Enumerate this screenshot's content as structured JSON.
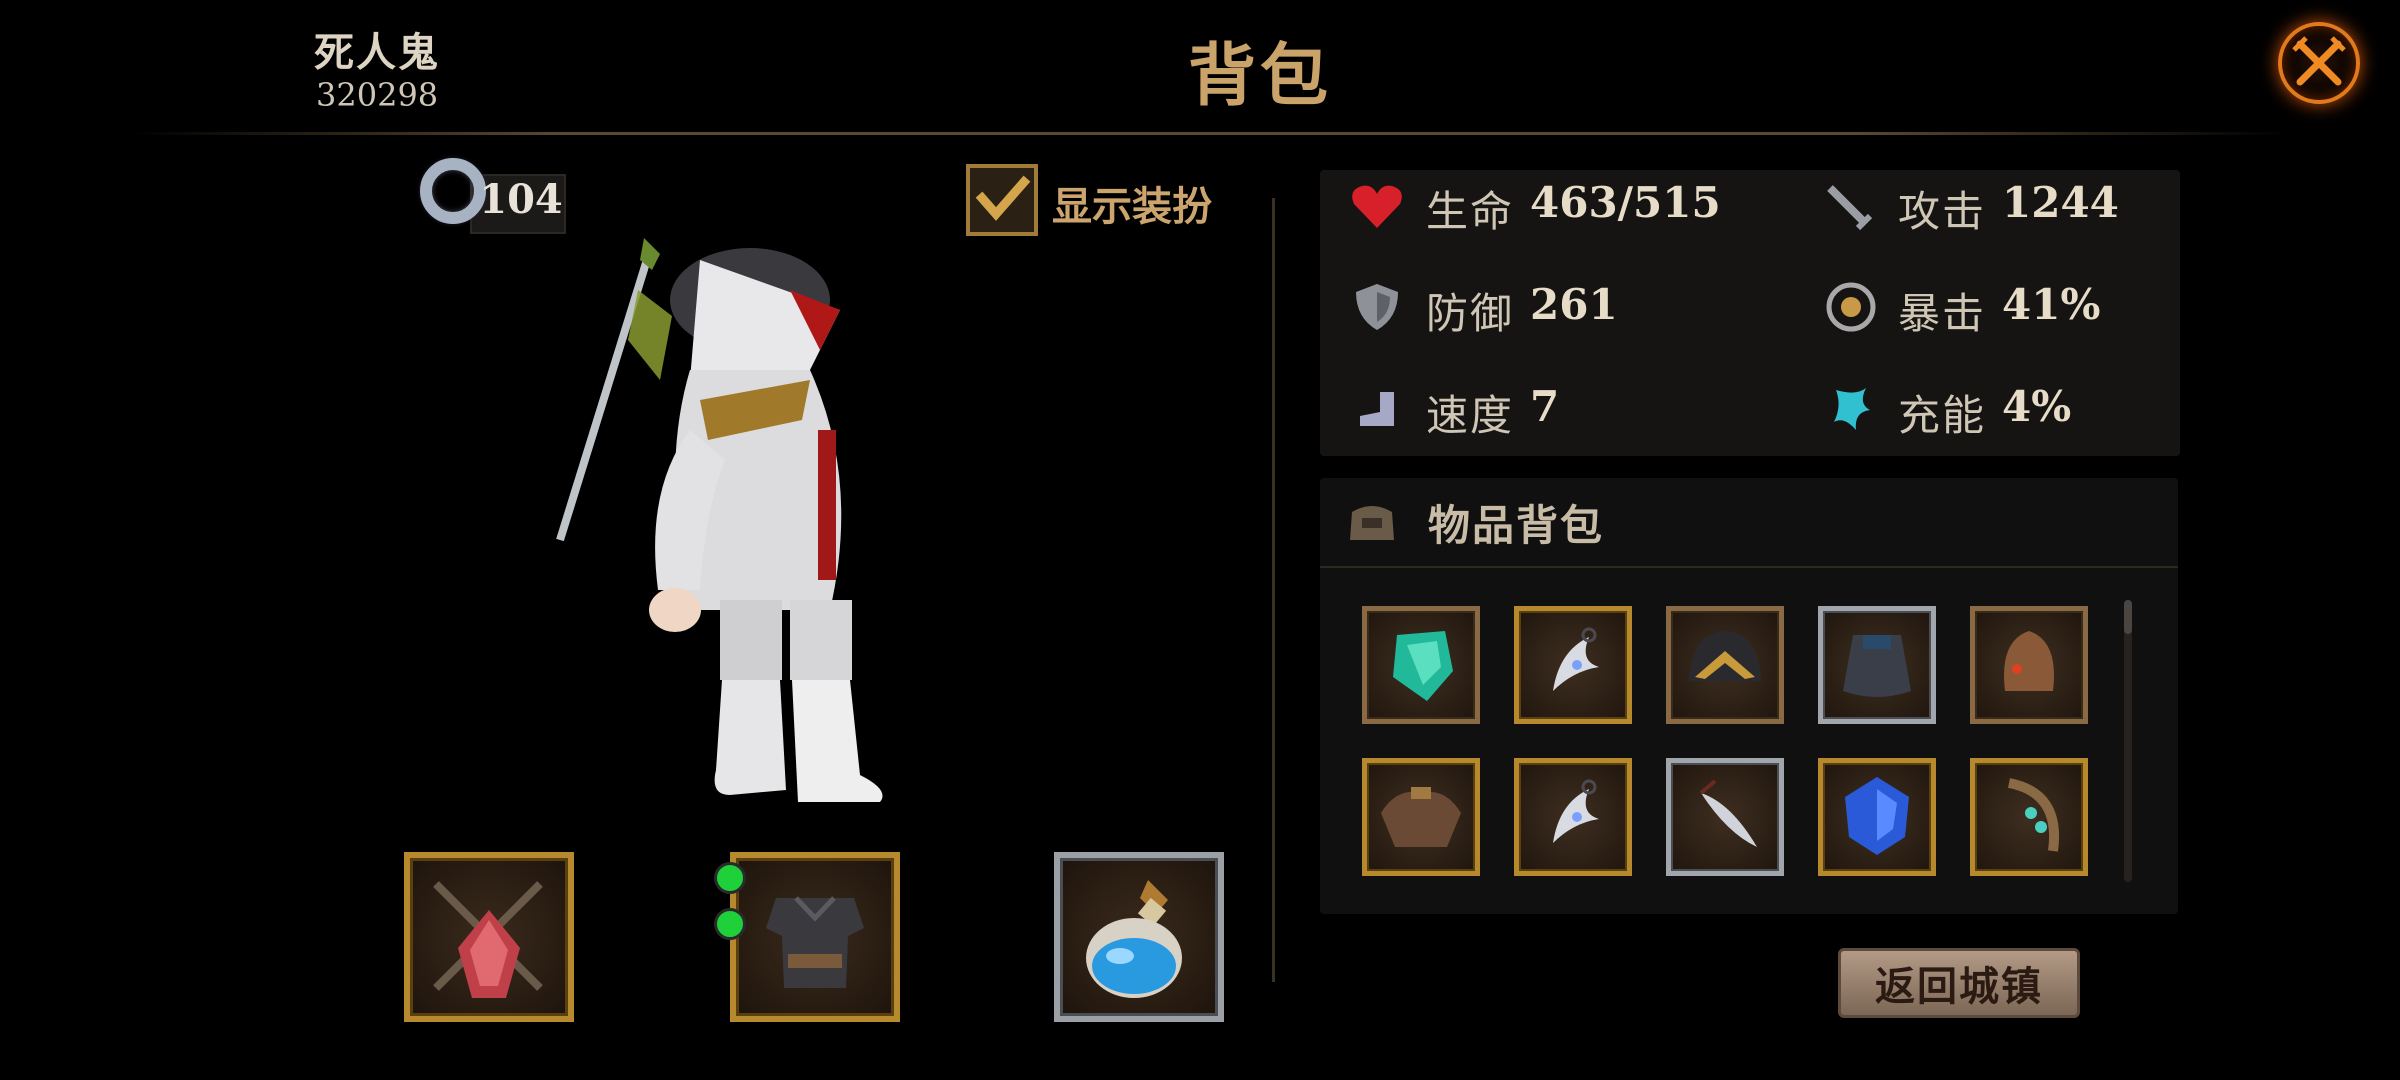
{
  "header": {
    "player_name": "死人鬼",
    "player_id": "320298",
    "title": "背包",
    "close_icon": "close-crossed-swords-icon"
  },
  "character": {
    "level": "104",
    "show_outfit_label": "显示装扮",
    "show_outfit_checked": true
  },
  "equipment_slots": [
    {
      "name": "weapon-slot",
      "icon": "crossed-blades-icon",
      "frame": "gold"
    },
    {
      "name": "armor-slot",
      "icon": "dark-armor-icon",
      "frame": "gold",
      "gems": 2
    },
    {
      "name": "potion-slot",
      "icon": "blue-potion-icon",
      "frame": "silver"
    }
  ],
  "stats": [
    {
      "icon": "heart-icon",
      "label": "生命",
      "value": "463/515"
    },
    {
      "icon": "sword-icon",
      "label": "攻击",
      "value": "1244"
    },
    {
      "icon": "shield-icon",
      "label": "防御",
      "value": "261"
    },
    {
      "icon": "critical-icon",
      "label": "暴击",
      "value": "41%"
    },
    {
      "icon": "boot-icon",
      "label": "速度",
      "value": "7"
    },
    {
      "icon": "energy-icon",
      "label": "充能",
      "value": "4%"
    }
  ],
  "inventory": {
    "title": "物品背包",
    "icon": "bag-icon",
    "items": [
      {
        "icon": "green-crystal-icon",
        "frame": "bronze"
      },
      {
        "icon": "crescent-amulet-icon",
        "frame": "gold"
      },
      {
        "icon": "dark-helmet-icon",
        "frame": "bronze"
      },
      {
        "icon": "dark-cape-icon",
        "frame": "silver"
      },
      {
        "icon": "leather-helmet-icon",
        "frame": "bronze"
      },
      {
        "icon": "leather-shoulders-icon",
        "frame": "gold"
      },
      {
        "icon": "crescent-amulet-icon",
        "frame": "gold"
      },
      {
        "icon": "dagger-amulet-icon",
        "frame": "silver"
      },
      {
        "icon": "blue-gem-icon",
        "frame": "gold"
      },
      {
        "icon": "bracelet-icon",
        "frame": "gold"
      }
    ]
  },
  "return_button": {
    "label": "返回城镇"
  },
  "colors": {
    "title_gold": "#c9a36a",
    "close_orange": "#e07a1a",
    "heart_red": "#d8202a",
    "energy_cyan": "#30c0d0"
  }
}
